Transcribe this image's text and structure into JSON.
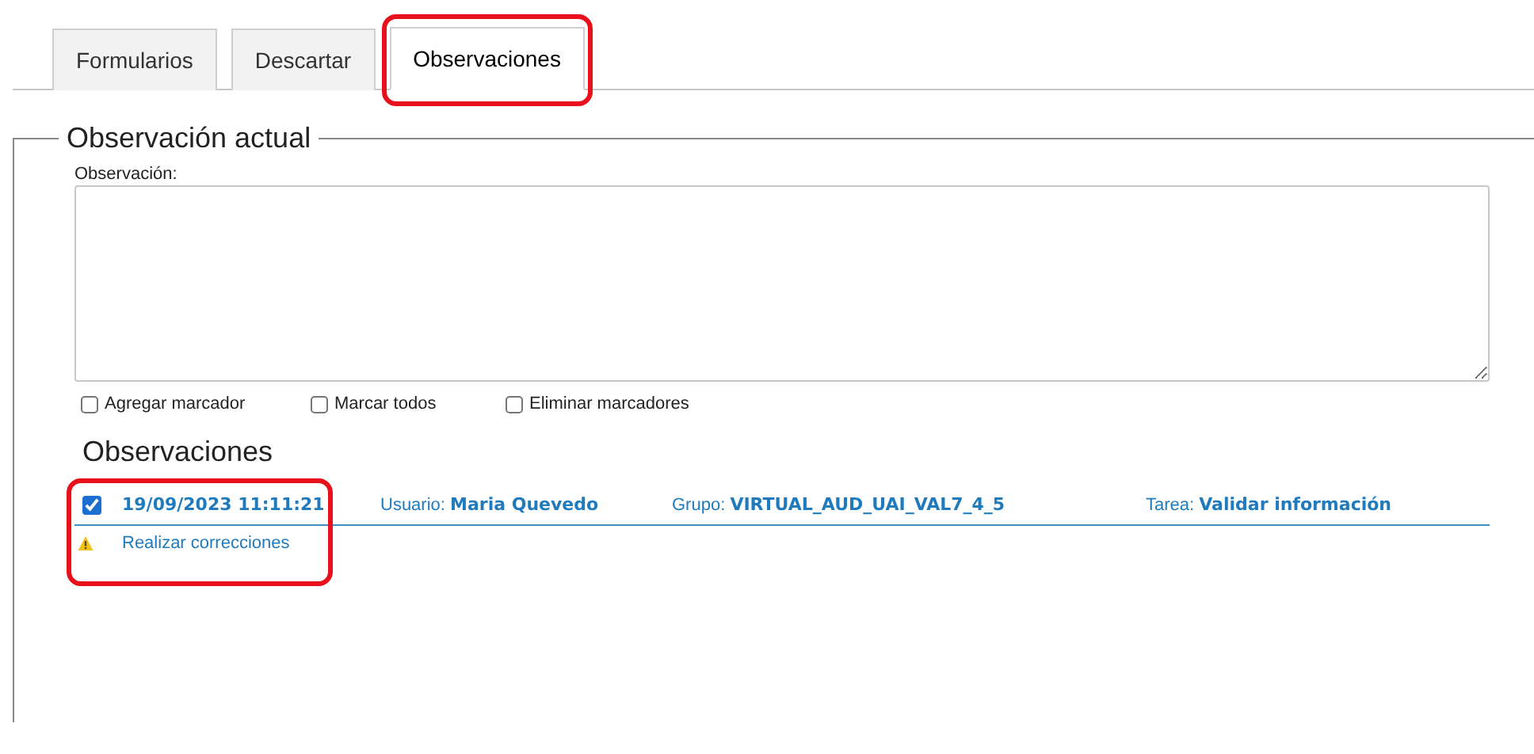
{
  "tabs": [
    {
      "label": "Formularios",
      "selected": false,
      "highlighted": false
    },
    {
      "label": "Descartar",
      "selected": false,
      "highlighted": false
    },
    {
      "label": "Observaciones",
      "selected": true,
      "highlighted": true
    }
  ],
  "current_observation": {
    "title": "Observación actual",
    "field_label": "Observación:",
    "options": [
      {
        "label": "Agregar marcador",
        "checked": false
      },
      {
        "label": "Marcar todos",
        "checked": false
      },
      {
        "label": "Eliminar marcadores",
        "checked": false
      }
    ]
  },
  "observations": {
    "title": "Observaciones",
    "items": [
      {
        "checked": true,
        "highlighted": true,
        "date": "19/09/2023 11:11:21",
        "user": "Usuario: **Maria Quevedo**",
        "group": "Grupo: **VIRTUAL_AUD_UAI_VAL7_4_5**",
        "task": "Tarea: **Validar información**",
        "warning": "Realizar correcciones"
      }
    ]
  }
}
